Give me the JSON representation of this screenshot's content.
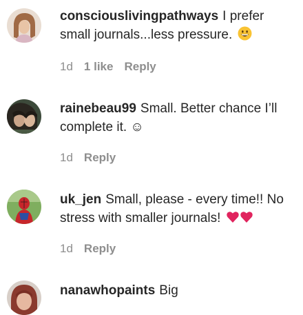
{
  "comments": [
    {
      "username": "consciouslivingpathways",
      "text": "I prefer small journals...less pressure.",
      "emoji": "grinning-face",
      "time": "1d",
      "likes": "1 like",
      "reply": "Reply"
    },
    {
      "username": "rainebeau99",
      "text": "Small. Better chance I’ll complete it. ☺",
      "time": "1d",
      "reply": "Reply"
    },
    {
      "username": "uk_jen",
      "text": "Small, please - every time!! No stress with smaller journals!",
      "emoji": "two-red-hearts",
      "time": "1d",
      "reply": "Reply"
    },
    {
      "username": "nanawhopaints",
      "text": "Big"
    }
  ],
  "colors": {
    "text": "#262626",
    "meta": "#8e8e8e",
    "heart": "#e0245e"
  }
}
